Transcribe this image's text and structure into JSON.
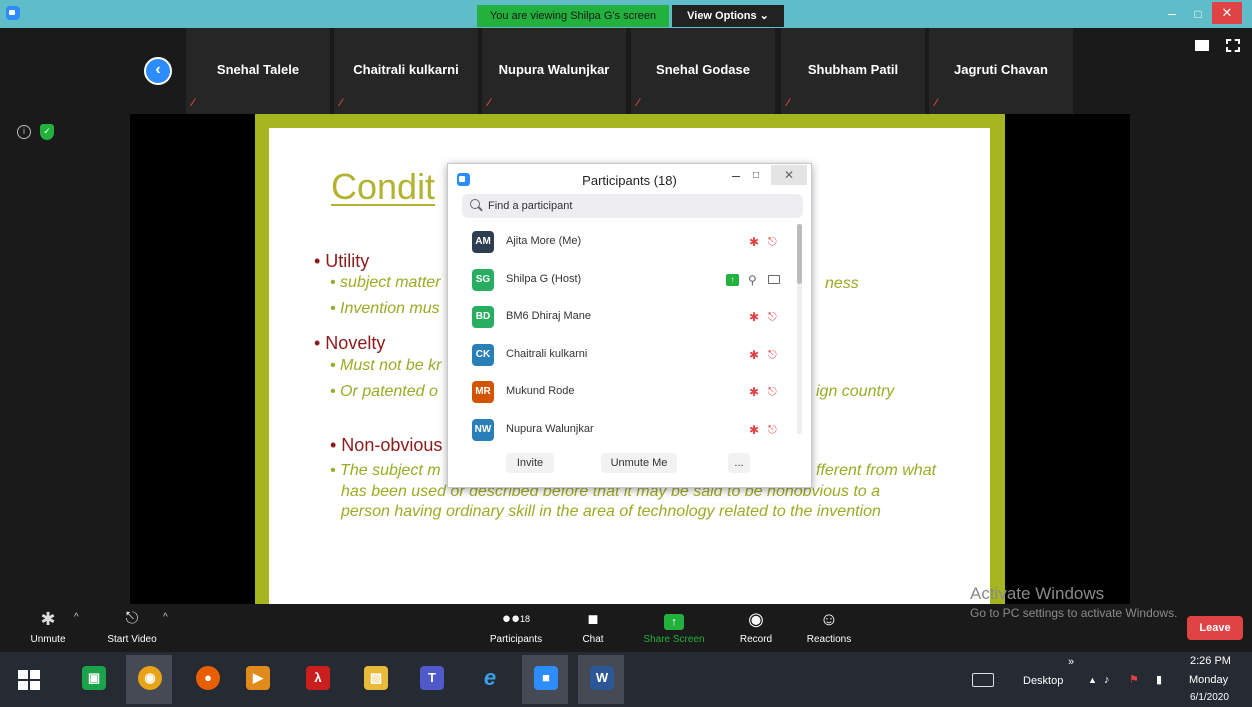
{
  "titlebar": {
    "viewing_banner": "You are viewing Shilpa G's screen",
    "view_options": "View Options ⌄",
    "minimize": "–",
    "maximize": "□",
    "close": "✕"
  },
  "strip": {
    "thumbnails": [
      {
        "name": "Snehal Talele"
      },
      {
        "name": "Chaitrali kulkarni"
      },
      {
        "name": "Nupura Walunjkar"
      },
      {
        "name": "Snehal Godase"
      },
      {
        "name": "Shubham Patil"
      },
      {
        "name": "Jagruti Chavan"
      }
    ]
  },
  "slide": {
    "title": "Condit",
    "utility": "• Utility",
    "utility_b1": "• subject matter",
    "utility_b1_tail": "ness",
    "utility_b2": "• Invention mus",
    "novelty": "• Novelty",
    "novelty_b1": "• Must not be kr",
    "novelty_b2": "• Or patented o",
    "novelty_b2_tail": "ign country",
    "nonobvious": "• Non-obvious",
    "nonobvious_b1": "• The subject m",
    "nonobvious_b1_tail": "fferent from what",
    "nonobvious_b1_line2": "has been used or described before that it may be said to be nonobvious to a",
    "nonobvious_b1_line3": "person having ordinary skill in the area of technology related to the invention"
  },
  "participants_panel": {
    "title": "Participants (18)",
    "search_placeholder": "Find a participant",
    "participants": [
      {
        "initials": "AM",
        "name": "Ajita More (Me)",
        "avatar_color": "#2c3e50"
      },
      {
        "initials": "SG",
        "name": "Shilpa G (Host)",
        "avatar_color": "#27ae60"
      },
      {
        "initials": "BD",
        "name": "BM6 Dhiraj Mane",
        "avatar_color": "#27ae60"
      },
      {
        "initials": "CK",
        "name": "Chaitrali kulkarni",
        "avatar_color": "#2980b9"
      },
      {
        "initials": "MR",
        "name": "Mukund Rode",
        "avatar_color": "#d35400"
      },
      {
        "initials": "NW",
        "name": "Nupura Walunjkar",
        "avatar_color": "#2980b9"
      }
    ],
    "invite": "Invite",
    "unmute_me": "Unmute Me",
    "more": "..."
  },
  "toolbar": {
    "unmute": "Unmute",
    "start_video": "Start Video",
    "participants": "Participants",
    "participants_count": "18",
    "chat": "Chat",
    "share_screen": "Share Screen",
    "record": "Record",
    "reactions": "Reactions",
    "leave": "Leave"
  },
  "watermark": {
    "title": "Activate Windows",
    "subtitle": "Go to PC settings to activate Windows."
  },
  "taskbar": {
    "desktop": "Desktop",
    "time": "2:26 PM",
    "day": "Monday",
    "date": "6/1/2020",
    "chevron": "»"
  },
  "colors": {
    "zoom_blue": "#2d8cff",
    "zoom_green": "#22b13d",
    "leave_red": "#e04343",
    "slide_frame": "#a5b520"
  }
}
